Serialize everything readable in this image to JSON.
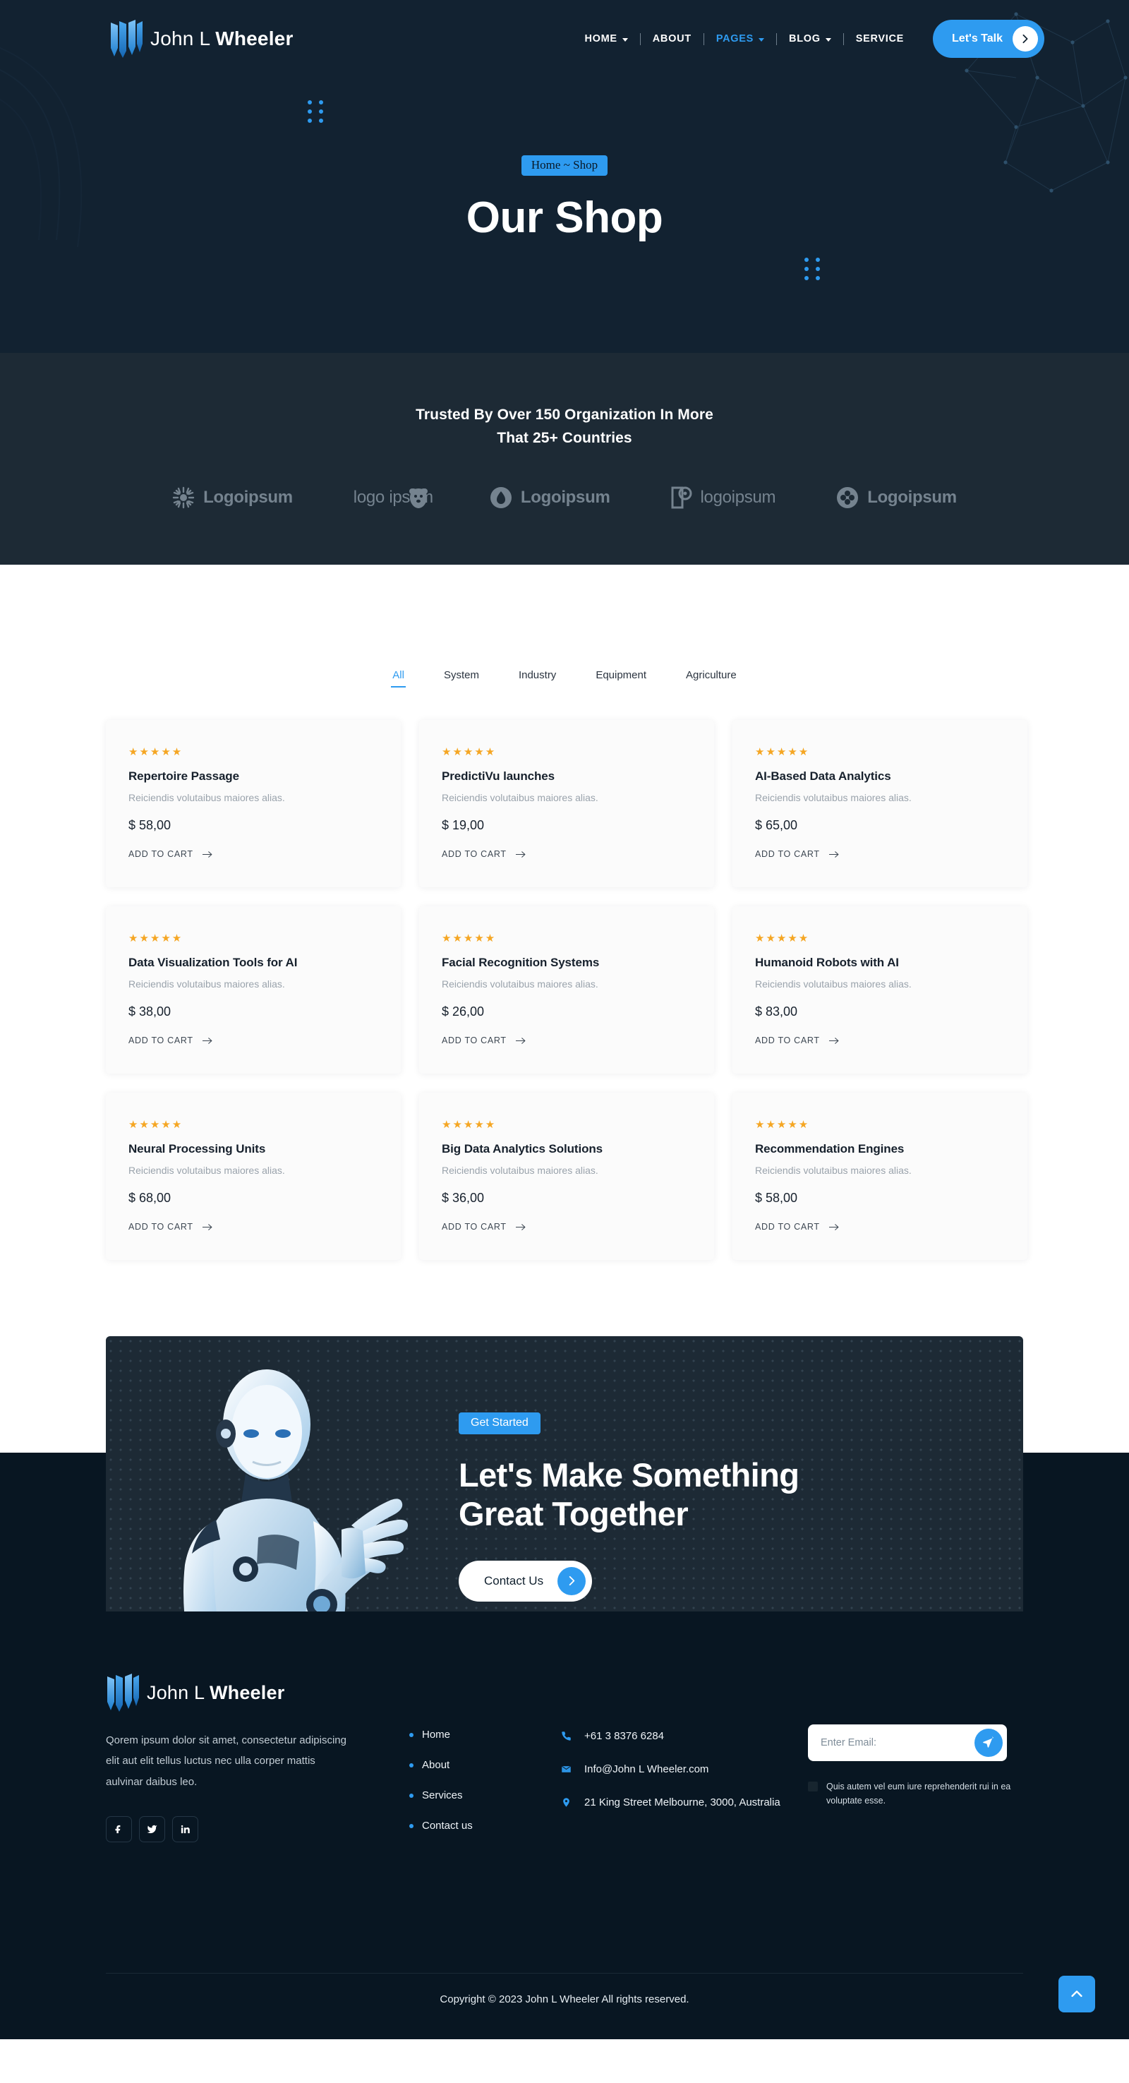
{
  "brand": {
    "name_light": "John L ",
    "name_bold": "Wheeler"
  },
  "nav": {
    "items": [
      {
        "label": "HOME",
        "caret": true,
        "active": false
      },
      {
        "label": "ABOUT",
        "caret": false,
        "active": false
      },
      {
        "label": "PAGES",
        "caret": true,
        "active": true
      },
      {
        "label": "BLOG",
        "caret": true,
        "active": false
      },
      {
        "label": "SERVICE",
        "caret": false,
        "active": false
      }
    ],
    "cta_label": "Let's Talk"
  },
  "hero": {
    "breadcrumb": "Home ~ Shop",
    "title": "Our Shop"
  },
  "trusted": {
    "headline_line1": "Trusted By Over 150 Organization In More",
    "headline_line2": "That 25+ Countries",
    "logos": [
      {
        "name": "Logoipsum",
        "icon": "sunburst-icon",
        "style": "bold"
      },
      {
        "name": "logo ipsum",
        "icon": "bear-icon",
        "style": "thin"
      },
      {
        "name": "Logoipsum",
        "icon": "drop-circle-icon",
        "style": "bold"
      },
      {
        "name": "logoipsum",
        "icon": "tag-icon",
        "style": "thin"
      },
      {
        "name": "Logoipsum",
        "icon": "clover-circle-icon",
        "style": "bold"
      }
    ]
  },
  "shop": {
    "tabs": [
      {
        "label": "All",
        "active": true
      },
      {
        "label": "System",
        "active": false
      },
      {
        "label": "Industry",
        "active": false
      },
      {
        "label": "Equipment",
        "active": false
      },
      {
        "label": "Agriculture",
        "active": false
      }
    ],
    "rating_stars": "★★★★★",
    "add_to_cart_label": "ADD TO CART",
    "products": [
      {
        "title": "Repertoire Passage",
        "desc": "Reiciendis volutaibus maiores alias.",
        "price": "$ 58,00"
      },
      {
        "title": "PredictiVu launches",
        "desc": "Reiciendis volutaibus maiores alias.",
        "price": "$ 19,00"
      },
      {
        "title": "AI-Based Data Analytics",
        "desc": "Reiciendis volutaibus maiores alias.",
        "price": "$ 65,00"
      },
      {
        "title": "Data Visualization Tools for AI",
        "desc": "Reiciendis volutaibus maiores alias.",
        "price": "$ 38,00"
      },
      {
        "title": "Facial Recognition Systems",
        "desc": "Reiciendis volutaibus maiores alias.",
        "price": "$ 26,00"
      },
      {
        "title": "Humanoid Robots with AI",
        "desc": "Reiciendis volutaibus maiores alias.",
        "price": "$ 83,00"
      },
      {
        "title": "Neural Processing Units",
        "desc": "Reiciendis volutaibus maiores alias.",
        "price": "$ 68,00"
      },
      {
        "title": "Big Data Analytics Solutions",
        "desc": "Reiciendis volutaibus maiores alias.",
        "price": "$ 36,00"
      },
      {
        "title": "Recommendation Engines",
        "desc": "Reiciendis volutaibus maiores alias.",
        "price": "$ 58,00"
      }
    ]
  },
  "cta": {
    "badge": "Get Started",
    "heading_line1": "Let's Make Something",
    "heading_line2": "Great Together",
    "button_label": "Contact Us"
  },
  "footer": {
    "about": "Qorem ipsum dolor sit amet, consectetur adipiscing elit aut elit tellus luctus nec ulla corper mattis aulvinar daibus leo.",
    "socials": [
      {
        "name": "facebook-icon"
      },
      {
        "name": "twitter-icon"
      },
      {
        "name": "linkedin-icon"
      }
    ],
    "links": [
      {
        "label": "Home"
      },
      {
        "label": "About"
      },
      {
        "label": "Services"
      },
      {
        "label": "Contact us"
      }
    ],
    "contacts": [
      {
        "icon": "phone-icon",
        "text": "+61 3 8376 6284"
      },
      {
        "icon": "mail-icon",
        "text": "Info@John L Wheeler.com"
      },
      {
        "icon": "location-icon",
        "text": "21 King Street Melbourne, 3000, Australia"
      }
    ],
    "newsletter": {
      "placeholder": "Enter Email:",
      "value": "",
      "send_icon": "send-icon"
    },
    "consent": "Quis autem vel eum iure reprehenderit rui in ea voluptate esse.",
    "copyright": "Copyright © 2023 John L Wheeler All rights reserved."
  },
  "colors": {
    "accent": "#2e9bf0",
    "hero_bg": "#122231",
    "trusted_bg": "#1d2a35",
    "footer_bg": "#081622",
    "star": "#f5a623"
  }
}
